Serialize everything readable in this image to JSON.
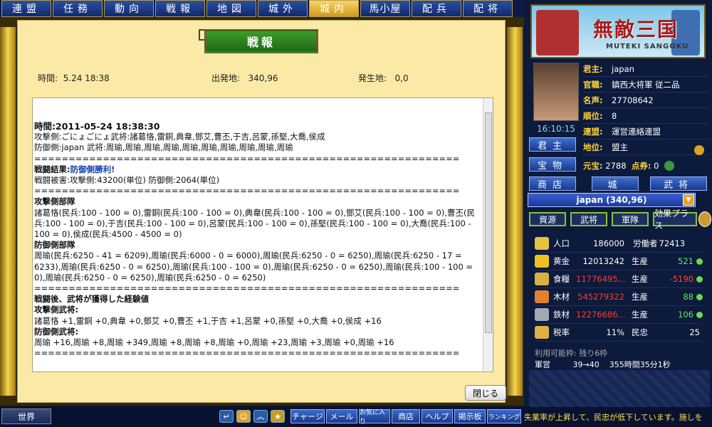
{
  "nav": [
    "連盟",
    "任務",
    "動向",
    "戦報",
    "地図",
    "城外",
    "城内",
    "馬小屋",
    "配兵",
    "配将"
  ],
  "nav_active": "城内",
  "report": {
    "title": "戦報",
    "time_label": "時間:",
    "time_value": "5.24  18:38",
    "origin_label": "出発地:",
    "origin_value": "340,96",
    "dest_label": "発生地:",
    "dest_value": "0,0",
    "lines": [
      {
        "t": "時間:2011-05-24 18:38:30",
        "c": "big"
      },
      {
        "t": "攻撃側:ごにょごにょ武将:諸葛恪,雷銅,典韋,鄧艾,曹丕,于吉,呂蒙,孫堅,大喬,侯成",
        "c": ""
      },
      {
        "t": "防御側:japan 武将:周瑜,周瑜,周瑜,周瑜,周瑜,周瑜,周瑜,周瑜,周瑜,周瑜",
        "c": ""
      },
      {
        "t": "==============================================================",
        "c": ""
      },
      {
        "t": "戦闘結果:",
        "c": "b",
        "x": "防御側勝利!"
      },
      {
        "t": "戦闘被害:攻撃側:43200(単位) 防御側:2064(単位)",
        "c": ""
      },
      {
        "t": "==============================================================",
        "c": ""
      },
      {
        "t": "攻撃側部隊",
        "c": "b"
      },
      {
        "t": "諸葛恪(民兵:100 - 100 = 0),雷銅(民兵:100 - 100 = 0),典韋(民兵:100 - 100 = 0),鄧艾(民兵:100 - 100 = 0),曹丕(民兵:100 - 100 = 0),于吉(民兵:100 - 100 = 0),呂蒙(民兵:100 - 100 = 0),孫堅(民兵:100 - 100 = 0),大喬(民兵:100 - 100 = 0),侯成(民兵:4500 - 4500 = 0)",
        "c": ""
      },
      {
        "t": "防御側部隊",
        "c": "b"
      },
      {
        "t": "周瑜(民兵:6250 - 41 = 6209),周瑜(民兵:6000 - 0 = 6000),周瑜(民兵:6250 - 0 = 6250),周瑜(民兵:6250 - 17 = 6233),周瑜(民兵:6250 - 0 = 6250),周瑜(民兵:100 - 100 = 0),周瑜(民兵:6250 - 0 = 6250),周瑜(民兵:100 - 100 = 0),周瑜(民兵:6250 - 0 = 6250),周瑜(民兵:6250 - 0 = 6250)",
        "c": ""
      },
      {
        "t": "==============================================================",
        "c": ""
      },
      {
        "t": "戦闘後、武将が獲得した経験値",
        "c": "b"
      },
      {
        "t": "攻撃側武将:",
        "c": "b"
      },
      {
        "t": "諸葛恪 +1,雷銅 +0,典韋 +0,鄧艾 +0,曹丕 +1,于吉 +1,呂蒙 +0,孫堅 +0,大喬 +0,侯成 +16",
        "c": ""
      },
      {
        "t": "防御側武将:",
        "c": "b"
      },
      {
        "t": "周瑜 +16,周瑜 +8,周瑜 +349,周瑜 +8,周瑜 +8,周瑜 +0,周瑜 +23,周瑜 +3,周瑜 +0,周瑜 +16",
        "c": ""
      },
      {
        "t": "==============================================================",
        "c": ""
      }
    ],
    "close_label": "閉じる"
  },
  "logo": {
    "title": "無敵三国",
    "subtitle": "MUTEKI SANGOKU"
  },
  "clock": "16:10:15",
  "profile": [
    {
      "k": "君主:",
      "v": "japan"
    },
    {
      "k": "官職:",
      "v": "鎮西大将軍 従二品"
    },
    {
      "k": "名声:",
      "v": "27708642"
    },
    {
      "k": "順位:",
      "v": "8"
    },
    {
      "k": "連盟:",
      "v": "運営連絡連盟"
    },
    {
      "k": "地位:",
      "v": "盟主"
    }
  ],
  "side_buttons": [
    "君主",
    "宝物",
    "商店",
    "城",
    "武将"
  ],
  "yuanbao": {
    "label": "元宝:",
    "value": "2788",
    "tk_label": "点券:",
    "tk_value": "0"
  },
  "location": "japan (340,96)",
  "res_tabs": [
    "資源",
    "武将",
    "軍隊",
    "効果プラス"
  ],
  "resources": [
    {
      "name": "人口",
      "value": "186000",
      "value_red": false,
      "label": "労働者",
      "gain": "72413",
      "gain_red": false,
      "icon_color": "#e8c040"
    },
    {
      "name": "黄金",
      "value": "12013242",
      "value_red": false,
      "label": "生産",
      "gain": "521",
      "gain_red": false,
      "icon_color": "#f0c020"
    },
    {
      "name": "食糧",
      "value": "11776495...",
      "value_red": true,
      "label": "生産",
      "gain": "-5190",
      "gain_red": true,
      "icon_color": "#d8b040"
    },
    {
      "name": "木材",
      "value": "545279322",
      "value_red": true,
      "label": "生産",
      "gain": "88",
      "gain_red": false,
      "icon_color": "#e08030"
    },
    {
      "name": "鉄材",
      "value": "12276686...",
      "value_red": true,
      "label": "生産",
      "gain": "106",
      "gain_red": false,
      "icon_color": "#a0a8b8"
    },
    {
      "name": "税率",
      "value": "11%",
      "value_red": false,
      "label": "民忠",
      "gain": "25",
      "gain_red": false,
      "icon_color": "#e0b040"
    }
  ],
  "bottom": {
    "l1": "利用可能枠: 残り6枠",
    "l2a": "軍営",
    "l2b": "39→40",
    "l2c": "355時間35分1秒"
  },
  "world_label": "世界",
  "bottom_buttons": [
    "チャージ",
    "メール",
    "お気に入り",
    "商店",
    "ヘルプ",
    "掲示板",
    "ランキング"
  ],
  "ticker": "失業率が上昇して、民忠が低下しています。施しを"
}
